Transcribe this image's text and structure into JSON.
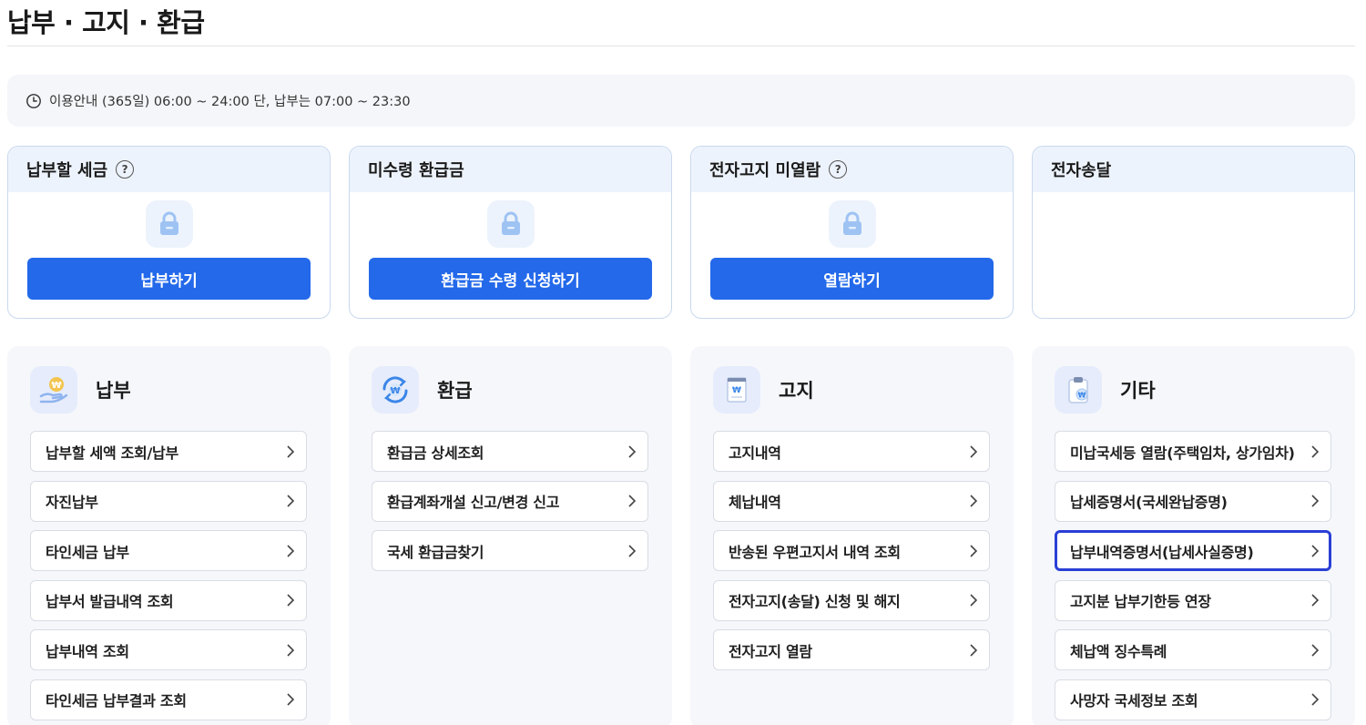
{
  "page": {
    "title": "납부 · 고지 · 환급"
  },
  "notice": {
    "icon": "clock-icon",
    "text": "이용안내 (365일) 06:00 ~ 24:00 단, 납부는 07:00 ~ 23:30"
  },
  "colors": {
    "primary": "#2369ea",
    "selected_border": "#2a3fd6",
    "card_head_bg": "#edf3fc",
    "panel_bg": "#f5f7fb"
  },
  "cards": [
    {
      "title": "납부할 세금",
      "help": "?",
      "button": "납부하기"
    },
    {
      "title": "미수령 환급금",
      "button": "환급금 수령 신청하기"
    },
    {
      "title": "전자고지 미열람",
      "help": "?",
      "button": "열람하기"
    },
    {
      "title": "전자송달"
    }
  ],
  "panels": [
    {
      "title": "납부",
      "icon": "hand-coin-icon",
      "items": [
        "납부할 세액 조회/납부",
        "자진납부",
        "타인세금 납부",
        "납부서 발급내역 조회",
        "납부내역 조회",
        "타인세금 납부결과 조회"
      ]
    },
    {
      "title": "환급",
      "icon": "refund-cycle-icon",
      "items": [
        "환급금 상세조회",
        "환급계좌개설 신고/변경 신고",
        "국세 환급금찾기"
      ]
    },
    {
      "title": "고지",
      "icon": "notice-document-icon",
      "items": [
        "고지내역",
        "체납내역",
        "반송된 우편고지서 내역 조회",
        "전자고지(송달) 신청 및 해지",
        "전자고지 열람"
      ]
    },
    {
      "title": "기타",
      "icon": "clipboard-coin-icon",
      "items": [
        "미납국세등 열람(주택임차, 상가임차)",
        "납세증명서(국세완납증명)",
        "납부내역증명서(납세사실증명)",
        "고지분 납부기한등 연장",
        "체납액 징수특례",
        "사망자 국세정보 조회"
      ],
      "selected_index": 2
    }
  ]
}
